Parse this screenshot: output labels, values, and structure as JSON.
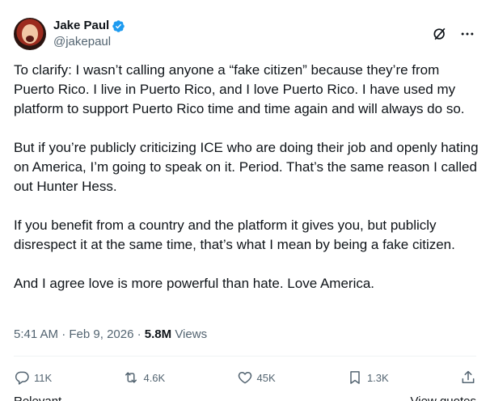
{
  "author": {
    "display_name": "Jake Paul",
    "handle": "@jakepaul"
  },
  "tweet": {
    "paragraphs": [
      "To clarify: I wasn’t calling anyone a “fake citizen” because they’re from Puerto Rico. I live in Puerto Rico, and I love Puerto Rico. I have used my platform to support Puerto Rico time and time again and will always do so.",
      "But if you’re publicly criticizing ICE who are doing their job and openly hating on America, I’m going to speak on it. Period. That’s the same reason I called out Hunter Hess.",
      "If you benefit from a country and the platform it gives you, but publicly disrespect it at the same time, that’s what I mean by being a fake citizen.",
      "And I agree love is more powerful than hate. Love America."
    ],
    "time": "5:41 AM",
    "date": "Feb 9, 2026",
    "separator": "·",
    "views_count": "5.8M",
    "views_label": "Views"
  },
  "actions": {
    "replies": "11K",
    "reposts": "4.6K",
    "likes": "45K",
    "bookmarks": "1.3K"
  },
  "footer": {
    "left": "Relevant",
    "right": "View quotes"
  },
  "colors": {
    "text": "#0f1419",
    "secondary": "#536471",
    "verified": "#1d9bf0",
    "divider": "#eff3f4"
  }
}
